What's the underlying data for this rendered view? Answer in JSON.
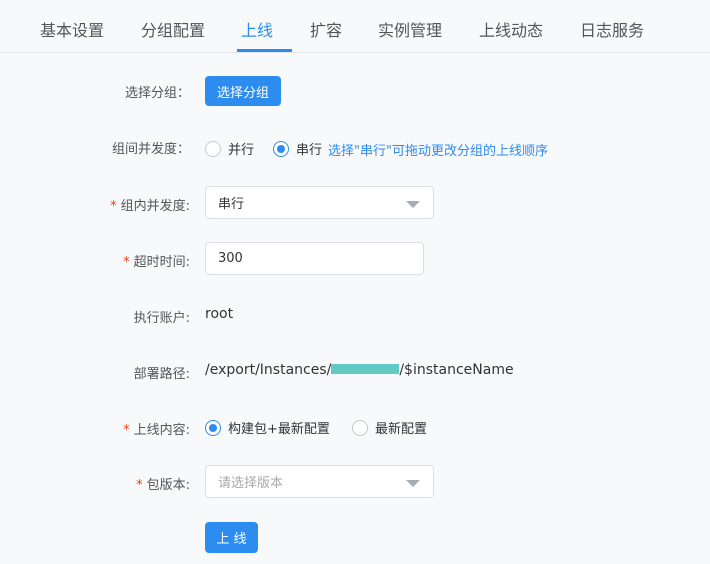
{
  "tabs": [
    {
      "label": "基本设置"
    },
    {
      "label": "分组配置"
    },
    {
      "label": "上线"
    },
    {
      "label": "扩容"
    },
    {
      "label": "实例管理"
    },
    {
      "label": "上线动态"
    },
    {
      "label": "日志服务"
    }
  ],
  "active_tab": "上线",
  "form": {
    "group_select": {
      "label": "选择分组：",
      "button": "选择分组"
    },
    "group_concurrency": {
      "label": "组间并发度：",
      "options": [
        "并行",
        "串行"
      ],
      "selected": "串行",
      "hint": "选择\"串行\"可拖动更改分组的上线顺序"
    },
    "in_group_concurrency": {
      "required_mark": "*",
      "label": "组内并发度:",
      "value": "串行"
    },
    "timeout": {
      "required_mark": "*",
      "label": "超时时间:",
      "value": "300"
    },
    "exec_account": {
      "label": "执行账户:",
      "value": "root"
    },
    "deploy_path": {
      "label": "部署路径:",
      "prefix": "/export/Instances/",
      "suffix": "/$instanceName"
    },
    "deploy_content": {
      "required_mark": "*",
      "label": "上线内容:",
      "options": [
        "构建包+最新配置",
        "最新配置"
      ],
      "selected": "构建包+最新配置"
    },
    "package_version": {
      "required_mark": "*",
      "label": "包版本:",
      "placeholder": "请选择版本"
    },
    "submit": "上 线"
  },
  "colors": {
    "accent": "#2d8cf0",
    "required": "#ed4014",
    "mask": "#63c9c3"
  }
}
